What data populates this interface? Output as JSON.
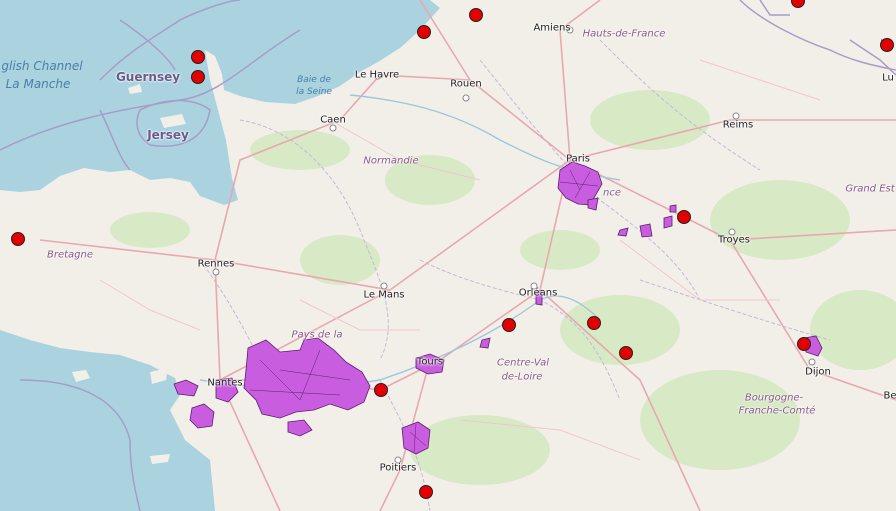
{
  "cities": [
    {
      "id": "amiens",
      "name": "Amiens"
    },
    {
      "id": "le-havre",
      "name": "Le Havre"
    },
    {
      "id": "rouen",
      "name": "Rouen"
    },
    {
      "id": "caen",
      "name": "Caen"
    },
    {
      "id": "reims",
      "name": "Reims"
    },
    {
      "id": "paris",
      "name": "Paris"
    },
    {
      "id": "troyes",
      "name": "Troyes"
    },
    {
      "id": "rennes",
      "name": "Rennes"
    },
    {
      "id": "le-mans",
      "name": "Le Mans"
    },
    {
      "id": "orleans",
      "name": "Orléans"
    },
    {
      "id": "tours",
      "name": "Tours"
    },
    {
      "id": "nantes",
      "name": "Nantes"
    },
    {
      "id": "dijon",
      "name": "Dijon"
    },
    {
      "id": "poitiers",
      "name": "Poitiers"
    }
  ],
  "regions": [
    {
      "id": "hauts-de-france",
      "name": "Hauts-de-France"
    },
    {
      "id": "normandie",
      "name": "Normandie"
    },
    {
      "id": "grand-est",
      "name": "Grand Est"
    },
    {
      "id": "bretagne",
      "name": "Bretagne"
    },
    {
      "id": "pays-de-la-loire",
      "name": "Pays de la"
    },
    {
      "id": "centre-val",
      "name": "Centre-Val"
    },
    {
      "id": "de-loire",
      "name": "de-Loire"
    },
    {
      "id": "bourgogne",
      "name": "Bourgogne-"
    },
    {
      "id": "franche-comte",
      "name": "Franche-Comté"
    },
    {
      "id": "idf-fragment",
      "name": "nce"
    }
  ],
  "water": {
    "channel_en": "glish Channel",
    "channel_fr": "La Manche",
    "baie_de": "Baie de",
    "la_seine": "la Seine"
  },
  "islands": {
    "guernsey": "Guernsey",
    "jersey": "Jersey"
  },
  "edge_labels": {
    "le": "Le",
    "lu": "Lu",
    "be": "Be"
  },
  "colors": {
    "sea": "#aad3df",
    "land": "#f2efe9",
    "forest": "#cfe6b8",
    "boundary": "#9e8fbf",
    "road": "#e8a8b0",
    "choropleth_fill": "#c95de0",
    "choropleth_stroke": "#5a1f6b",
    "marker": "#e30000"
  }
}
